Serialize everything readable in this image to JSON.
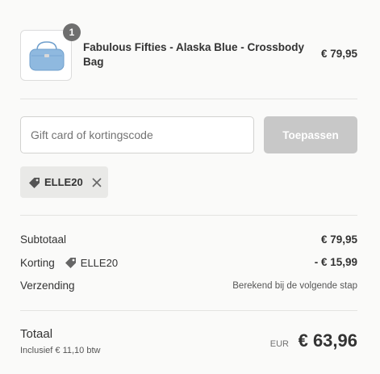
{
  "product": {
    "quantity": "1",
    "title": "Fabulous Fifties - Alaska Blue - Crossbody Bag",
    "price": "€ 79,95",
    "image_icon": "blue-crossbody-bag"
  },
  "discount": {
    "placeholder": "Gift card of kortingscode",
    "apply_label": "Toepassen",
    "applied_code": "ELLE20"
  },
  "summary": {
    "subtotal_label": "Subtotaal",
    "subtotal_value": "€ 79,95",
    "discount_label": "Korting",
    "discount_code": "ELLE20",
    "discount_value": "- € 15,99",
    "shipping_label": "Verzending",
    "shipping_value": "Berekend bij de volgende stap"
  },
  "total": {
    "label": "Totaal",
    "tax_note": "Inclusief € 11,10 btw",
    "currency": "EUR",
    "amount": "€ 63,96"
  },
  "colors": {
    "background": "#fafaf9",
    "apply_button_disabled": "#c8c8c8",
    "tag_background": "#e9e9e7",
    "bag_blue": "#8fb9df"
  }
}
